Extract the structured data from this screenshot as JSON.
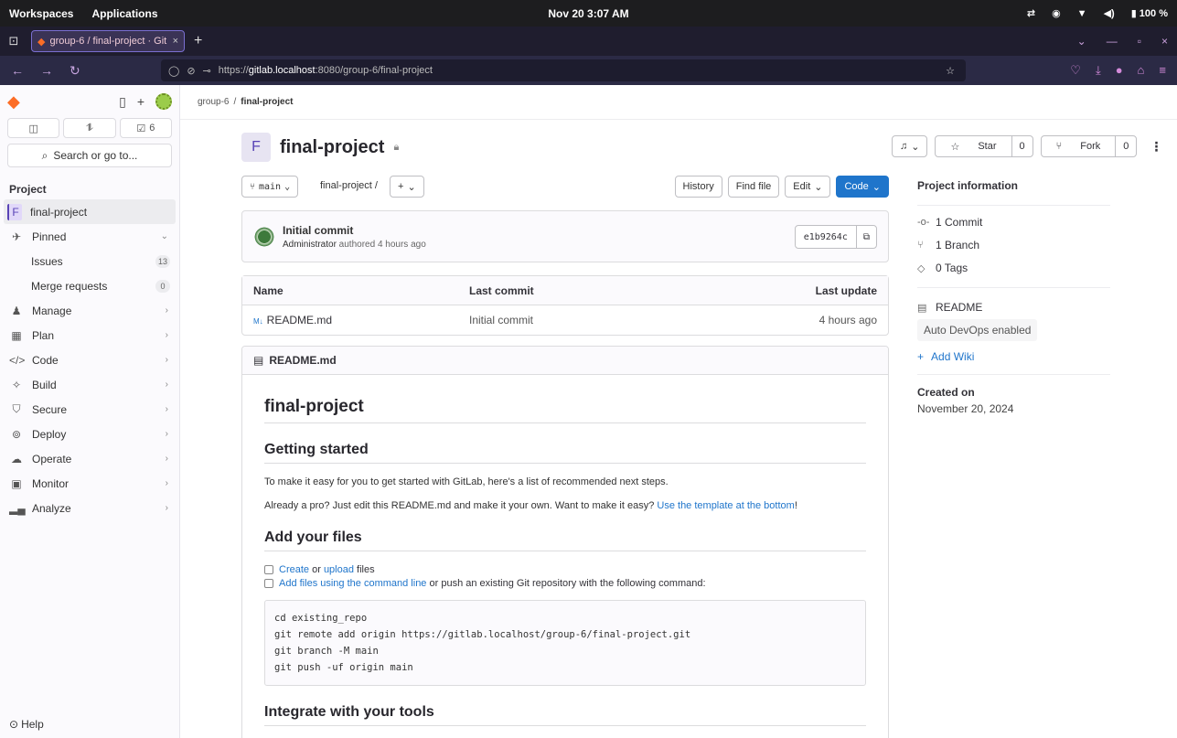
{
  "os": {
    "workspaces": "Workspaces",
    "applications": "Applications",
    "clock": "Nov 20  3:07 AM",
    "battery": "100 %"
  },
  "browser": {
    "tab_title": "group-6 / final-project · Git",
    "url_prefix": "https://",
    "url_host": "gitlab.localhost",
    "url_rest": ":8080/group-6/final-project"
  },
  "sidebar": {
    "issues_count": "6",
    "search_label": "Search or go to...",
    "section": "Project",
    "project_item": "final-project",
    "project_letter": "F",
    "pinned": "Pinned",
    "sub_items": [
      {
        "label": "Issues",
        "badge": "13"
      },
      {
        "label": "Merge requests",
        "badge": "0"
      }
    ],
    "items": [
      {
        "label": "Manage",
        "icon": "& "
      },
      {
        "label": "Plan",
        "icon": "☷"
      },
      {
        "label": "Code",
        "icon": "</>"
      },
      {
        "label": "Build",
        "icon": "⚙"
      },
      {
        "label": "Secure",
        "icon": "⛉"
      },
      {
        "label": "Deploy",
        "icon": "⇪"
      },
      {
        "label": "Operate",
        "icon": "◈"
      },
      {
        "label": "Monitor",
        "icon": "▣"
      },
      {
        "label": "Analyze",
        "icon": "▐"
      }
    ],
    "help": "Help"
  },
  "breadcrumb": {
    "group": "group-6",
    "separator": "/",
    "project": "final-project"
  },
  "project": {
    "letter": "F",
    "name": "final-project",
    "star_label": "Star",
    "star_count": "0",
    "fork_label": "Fork",
    "fork_count": "0"
  },
  "repo": {
    "branch": "main",
    "path": "final-project",
    "path_sep": "/",
    "history": "History",
    "find_file": "Find file",
    "edit": "Edit",
    "code": "Code"
  },
  "commit": {
    "title": "Initial commit",
    "author": "Administrator",
    "meta": " authored 4 hours ago",
    "sha": "e1b9264c"
  },
  "files": {
    "headers": [
      "Name",
      "Last commit",
      "Last update"
    ],
    "rows": [
      {
        "name": "README.md",
        "last_commit": "Initial commit",
        "last_update": "4 hours ago"
      }
    ]
  },
  "readme": {
    "filename": "README.md",
    "h1": "final-project",
    "h2_getting_started": "Getting started",
    "p1": "To make it easy for you to get started with GitLab, here's a list of recommended next steps.",
    "p2_text": "Already a pro? Just edit this README.md and make it your own. Want to make it easy? ",
    "p2_link": "Use the template at the bottom",
    "p2_end": "!",
    "h2_add_files": "Add your files",
    "task1_link1": "Create",
    "task1_or": " or ",
    "task1_link2": "upload",
    "task1_end": " files",
    "task2_link": "Add files using the command line",
    "task2_end": " or push an existing Git repository with the following command:",
    "code_lines": [
      "cd existing_repo",
      "git remote add origin https://gitlab.localhost/group-6/final-project.git",
      "git branch -M main",
      "git push -uf origin main"
    ],
    "h2_integrate": "Integrate with your tools"
  },
  "info": {
    "title": "Project information",
    "commits": "1 Commit",
    "branches": "1 Branch",
    "tags": "0 Tags",
    "readme": "README",
    "autodevops": "Auto DevOps enabled",
    "add_wiki": "Add Wiki",
    "created_label": "Created on",
    "created_value": "November 20, 2024"
  }
}
